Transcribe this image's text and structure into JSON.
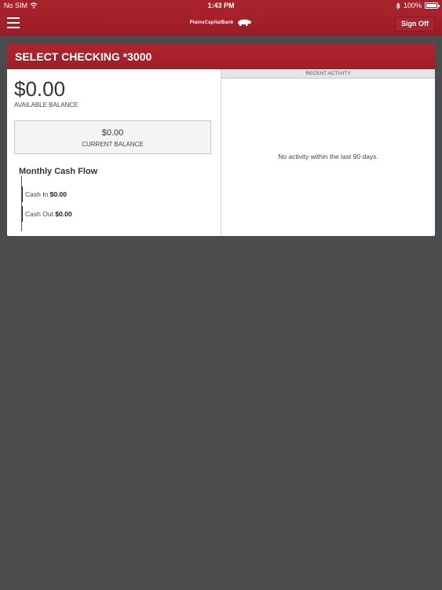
{
  "status_bar": {
    "carrier": "No SIM",
    "time": "1:43 PM",
    "battery": "100%"
  },
  "nav": {
    "logo_text": "PlainsCapitalBank",
    "sign_off_label": "Sign Off"
  },
  "account": {
    "title": "SELECT CHECKING *3000",
    "available_balance": "$0.00",
    "available_label": "AVAILABLE BALANCE",
    "current_balance": "$0.00",
    "current_label": "CURRENT BALANCE"
  },
  "cash_flow": {
    "title": "Monthly Cash Flow",
    "cash_in_label": "Cash In",
    "cash_in_value": "$0.00",
    "cash_out_label": "Cash Out",
    "cash_out_value": "$0.00"
  },
  "recent_activity": {
    "header": "RECENT ACTIVITY",
    "empty_message": "No activity within the last 90 days."
  },
  "colors": {
    "brand_red": "#a8222c",
    "background": "#4a4b4d"
  }
}
